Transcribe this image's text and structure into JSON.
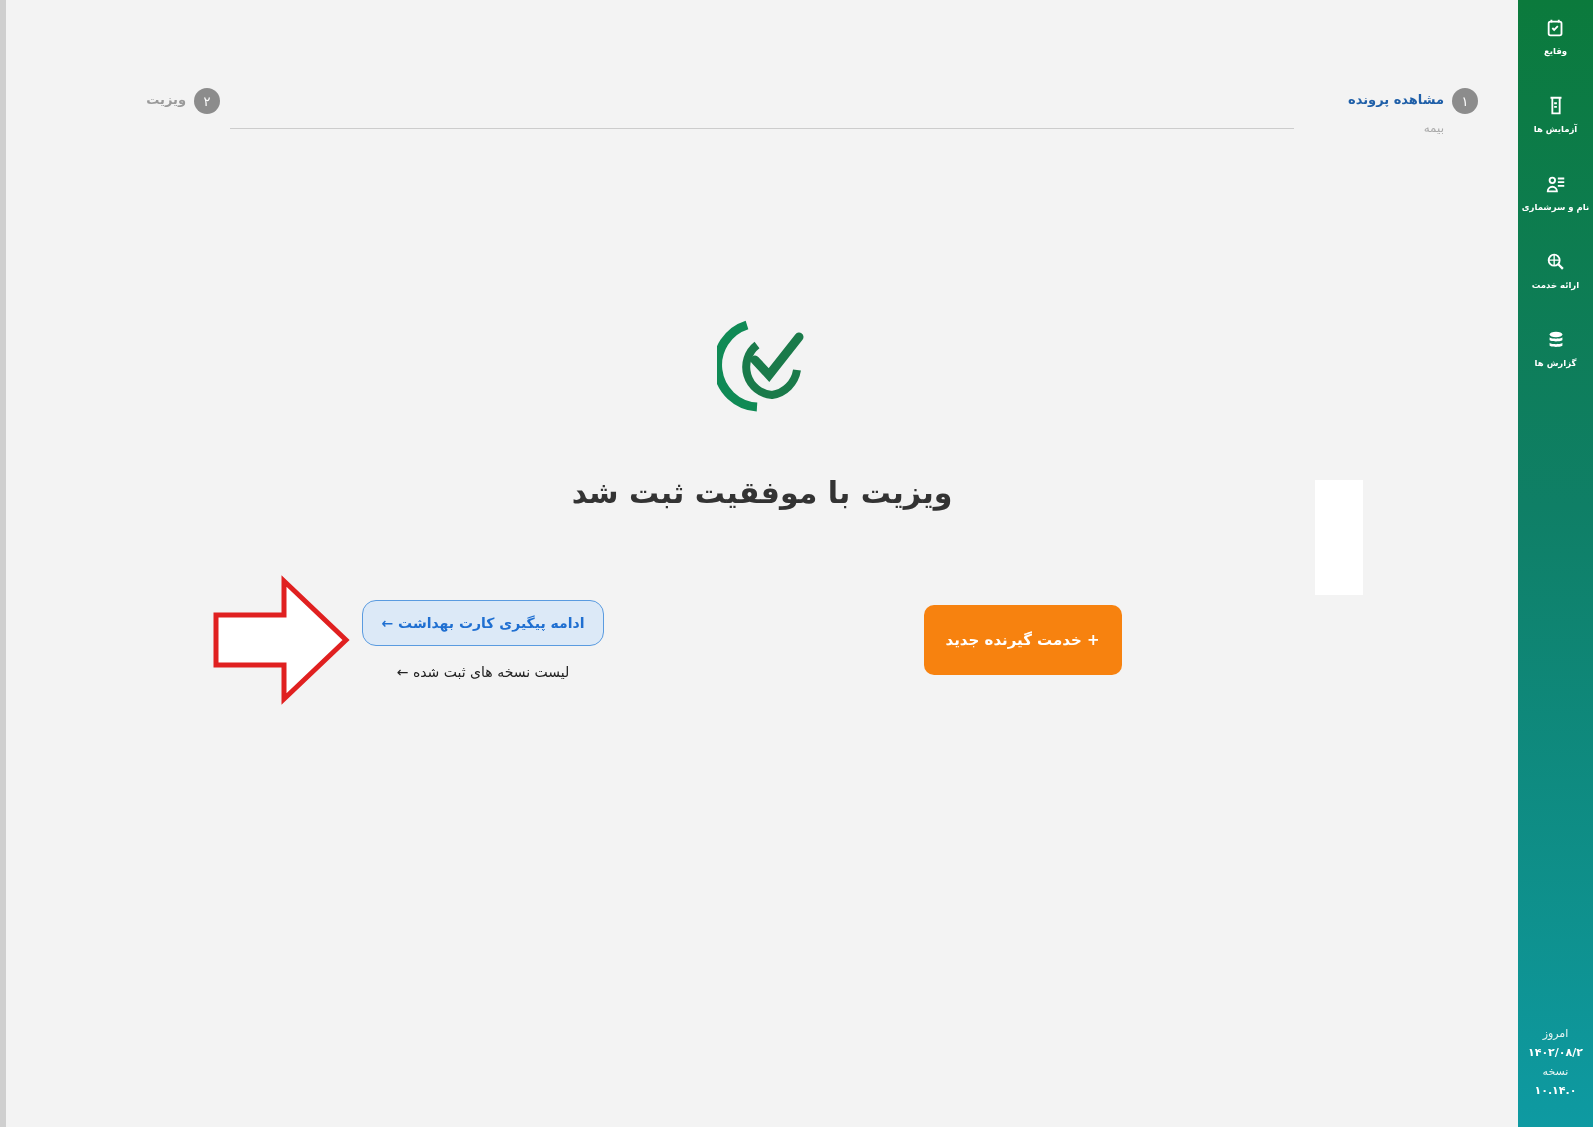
{
  "stepper": {
    "steps": [
      {
        "number": "۱",
        "label": "مشاهده پرونده",
        "sublabel": "بیمه",
        "selected": true
      },
      {
        "number": "۲",
        "label": "ویزیت",
        "selected": false
      }
    ]
  },
  "success": {
    "title": "ویزیت با موفقیت ثبت شد"
  },
  "actions": {
    "continue_button": "ادامه پیگیری کارت بهداشت ←",
    "list_link": "لیست نسخه های ثبت شده ←",
    "new_client_button": "+ خدمت گیرنده جدید"
  },
  "sidebar": {
    "items": [
      {
        "label": "وقایع"
      },
      {
        "label": "آزمایش ها"
      },
      {
        "label": "نام و سرشماری"
      },
      {
        "label": "ارائه خدمت"
      },
      {
        "label": "گزارش ها"
      }
    ],
    "today_label": "امروز",
    "today_date": "۱۴۰۲/۰۸/۲",
    "version_label": "نسخه",
    "version": "۱۰.۱۴.۰"
  }
}
